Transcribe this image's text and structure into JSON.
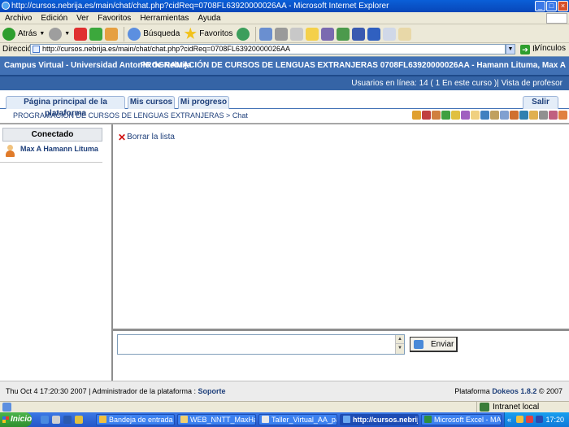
{
  "window": {
    "title": "http://cursos.nebrija.es/main/chat/chat.php?cidReq=0708FL63920000026AA - Microsoft Internet Explorer",
    "min": "_",
    "max": "□",
    "close": "×"
  },
  "menu": {
    "items": [
      "Archivo",
      "Edición",
      "Ver",
      "Favoritos",
      "Herramientas",
      "Ayuda"
    ]
  },
  "toolbar": {
    "back_label": "Atrás",
    "search_label": "Búsqueda",
    "favorites_label": "Favoritos"
  },
  "address": {
    "label": "Dirección",
    "url": "http://cursos.nebrija.es/main/chat/chat.php?cidReq=0708FL63920000026AA",
    "go_label": "Ir",
    "links_label": "Vínculos"
  },
  "site": {
    "campus_title": "Campus Virtual - Universidad Antonio de Nebrija",
    "course_header": "PROGRAMACIÓN DE CURSOS DE LENGUAS EXTRANJERAS 0708FL63920000026AA - Hamann Lituma, Max A",
    "online_users": "Usuarios en línea: 14 ( 1 En este curso )| Vista de profesor",
    "tabs": [
      "Página principal de la plataforma",
      "Mis cursos",
      "Mi progreso"
    ],
    "logout_label": "Salir",
    "breadcrumb": {
      "course": "PROGRAMACIÓN DE CURSOS DE LENGUAS EXTRANJERAS",
      "separator": " > ",
      "current": "Chat"
    }
  },
  "chat": {
    "connected_title": "Conectado",
    "users": [
      "Max A Hamann Lituma"
    ],
    "clear_list_label": "Borrar la lista",
    "message_value": "",
    "send_label": "Enviar"
  },
  "footer": {
    "left_text": "Thu Oct 4 17:20:30 2007 | Administrador de la plataforma : ",
    "support_link": "Soporte",
    "platform_text": "Plataforma ",
    "platform_link": "Dokeos 1.8.2",
    "copyright": " © 2007"
  },
  "statusbar": {
    "zone_label": "Intranet local"
  },
  "taskbar": {
    "start_label": "Inicio",
    "tasks": [
      "Bandeja de entrada - ...",
      "WEB_NNTT_MaxHam...",
      "Taller_Virtual_AA_pa...",
      "http://cursos.nebrij...",
      "Microsoft Excel - MAT..."
    ],
    "tray_chevron": "«",
    "clock": "17:20"
  },
  "colors": {
    "header_blue": "#4171B5",
    "link_blue": "#1E3F7A",
    "delete_red": "#D01010"
  }
}
